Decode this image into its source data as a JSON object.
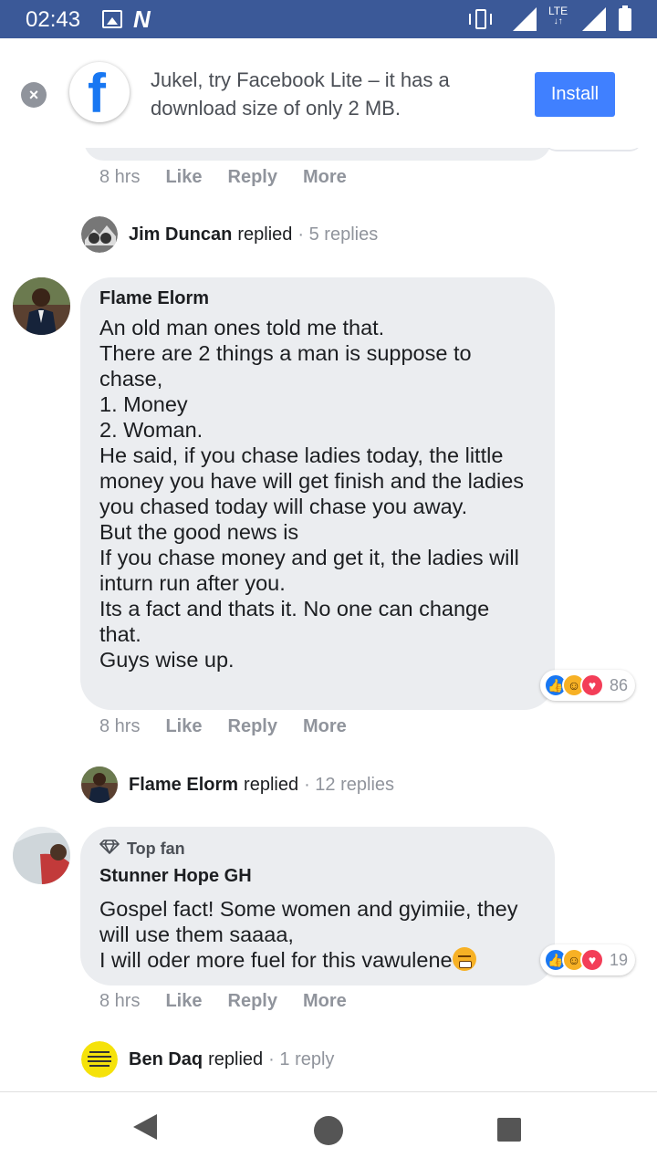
{
  "status_bar": {
    "time": "02:43",
    "network_type": "LTE",
    "icons": [
      "gallery-icon",
      "n-app-icon",
      "vibrate-icon",
      "signal-icon",
      "lte-icon",
      "signal-icon",
      "battery-icon"
    ]
  },
  "promo": {
    "text": "Jukel, try Facebook Lite – it has a download size of only 2 MB.",
    "install_label": "Install",
    "logo": "f",
    "close_icon": "×"
  },
  "comments": [
    {
      "actions": {
        "time": "8 hrs",
        "like": "Like",
        "reply": "Reply",
        "more": "More"
      },
      "reply_summary": {
        "name": "Jim Duncan",
        "verb": "replied",
        "count": "· 5 replies"
      }
    },
    {
      "author": "Flame Elorm",
      "body": "An old man ones told me that.\nThere are 2 things a man is suppose to chase,\n1. Money\n2. Woman.\nHe said, if you chase ladies today, the little money you have will get finish and the ladies you chased today will chase you away.\nBut the good news is\nIf you chase money and get it, the ladies will inturn run after you.\nIts a fact and thats it. No one can change that.\nGuys wise up.",
      "reaction_count": "86",
      "actions": {
        "time": "8 hrs",
        "like": "Like",
        "reply": "Reply",
        "more": "More"
      },
      "reply_summary": {
        "name": "Flame Elorm",
        "verb": "replied",
        "count": "· 12 replies"
      }
    },
    {
      "badge": "Top fan",
      "author": "Stunner Hope GH",
      "body": "Gospel fact! Some women and gyimiie, they will use them saaaa,\nI will oder more fuel for this vawulene",
      "reaction_count": "19",
      "actions": {
        "time": "8 hrs",
        "like": "Like",
        "reply": "Reply",
        "more": "More"
      },
      "reply_summary": {
        "name": "Ben Daq",
        "verb": "replied",
        "count": "· 1 reply"
      }
    }
  ],
  "colors": {
    "status_bar": "#3b5998",
    "bubble": "#ebedf0",
    "install": "#4080ff",
    "meta_text": "#90949c"
  }
}
